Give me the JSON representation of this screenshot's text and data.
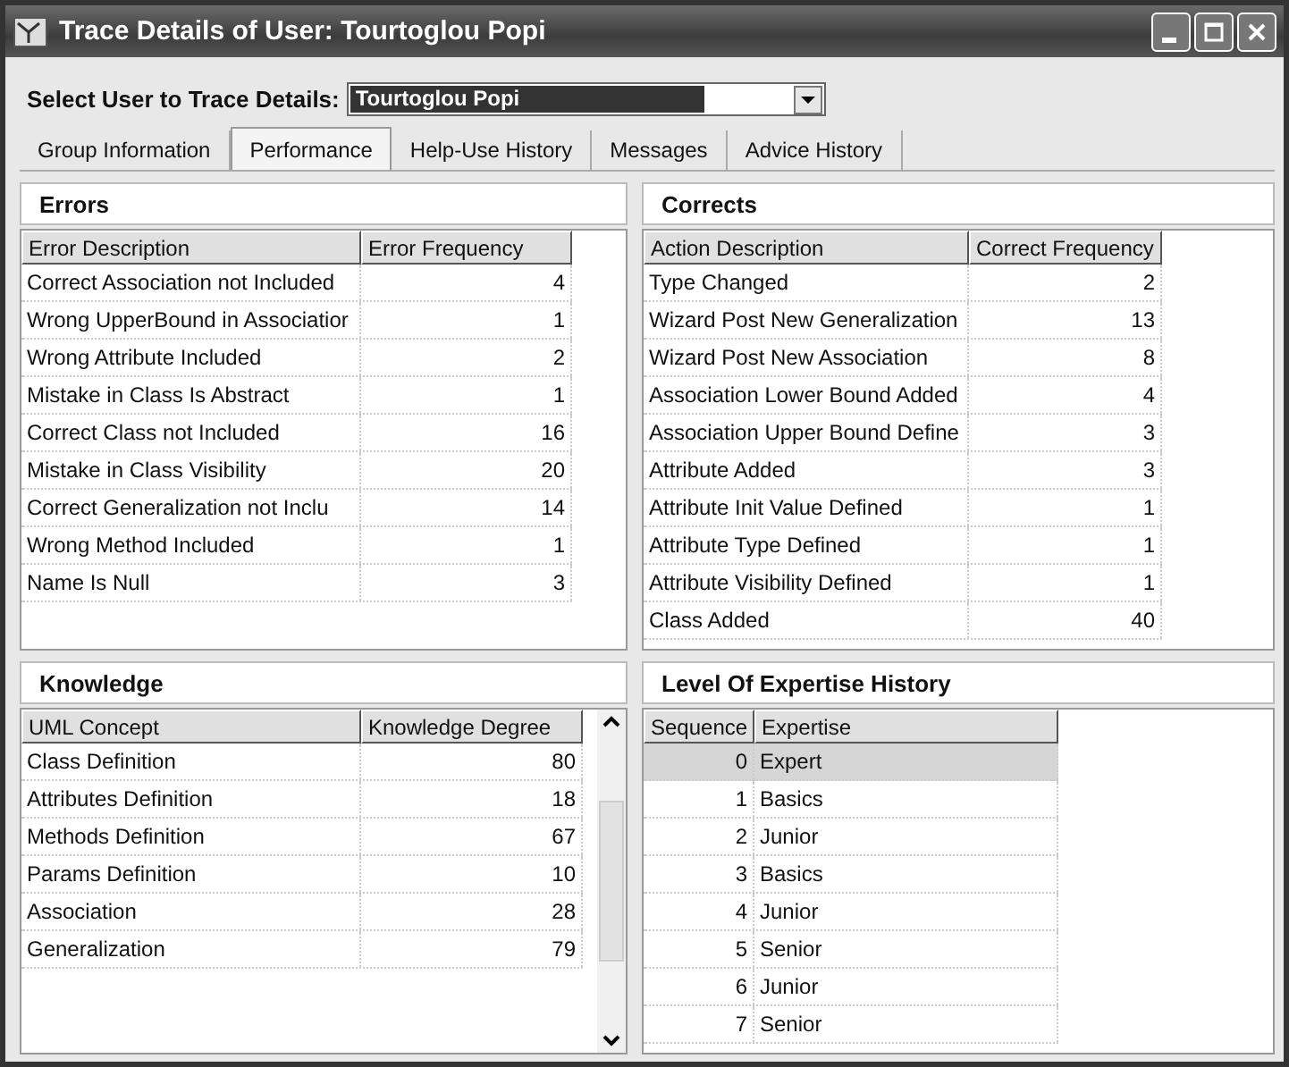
{
  "window": {
    "title": "Trace Details of User: Tourtoglou Popi"
  },
  "user_select": {
    "label": "Select User to Trace Details:",
    "value": "Tourtoglou Popi"
  },
  "tabs": [
    {
      "label": "Group Information",
      "selected": false
    },
    {
      "label": "Performance",
      "selected": true
    },
    {
      "label": "Help-Use History",
      "selected": false
    },
    {
      "label": "Messages",
      "selected": false
    },
    {
      "label": "Advice History",
      "selected": false
    }
  ],
  "panels": [
    {
      "title": "Errors",
      "scrollbar": false,
      "columns": [
        {
          "label": "Error Description",
          "kind": "text"
        },
        {
          "label": "Error Frequency",
          "kind": "number"
        }
      ],
      "rows": [
        {
          "cells": [
            "Correct Association not Included",
            "4"
          ],
          "selected": false
        },
        {
          "cells": [
            "Wrong UpperBound in Associatior",
            "1"
          ],
          "selected": false
        },
        {
          "cells": [
            "Wrong Attribute Included",
            "2"
          ],
          "selected": false
        },
        {
          "cells": [
            "Mistake in Class Is Abstract",
            "1"
          ],
          "selected": false
        },
        {
          "cells": [
            "Correct Class not Included",
            "16"
          ],
          "selected": false
        },
        {
          "cells": [
            "Mistake in Class Visibility",
            "20"
          ],
          "selected": false
        },
        {
          "cells": [
            "Correct Generalization not Inclu",
            "14"
          ],
          "selected": false
        },
        {
          "cells": [
            "Wrong Method Included",
            "1"
          ],
          "selected": false
        },
        {
          "cells": [
            "Name Is Null",
            "3"
          ],
          "selected": false
        }
      ]
    },
    {
      "title": "Corrects",
      "scrollbar": false,
      "columns": [
        {
          "label": "Action Description",
          "kind": "text"
        },
        {
          "label": "Correct Frequency",
          "kind": "number"
        }
      ],
      "rows": [
        {
          "cells": [
            "Type Changed",
            "2"
          ],
          "selected": false
        },
        {
          "cells": [
            "Wizard Post New Generalization",
            "13"
          ],
          "selected": false
        },
        {
          "cells": [
            "Wizard Post New Association",
            "8"
          ],
          "selected": false
        },
        {
          "cells": [
            "Association Lower Bound Added",
            "4"
          ],
          "selected": false
        },
        {
          "cells": [
            "Association Upper Bound Define",
            "3"
          ],
          "selected": false
        },
        {
          "cells": [
            "Attribute Added",
            "3"
          ],
          "selected": false
        },
        {
          "cells": [
            "Attribute Init Value Defined",
            "1"
          ],
          "selected": false
        },
        {
          "cells": [
            "Attribute Type Defined",
            "1"
          ],
          "selected": false
        },
        {
          "cells": [
            "Attribute Visibility Defined",
            "1"
          ],
          "selected": false
        },
        {
          "cells": [
            "Class Added",
            "40"
          ],
          "selected": false
        }
      ]
    },
    {
      "title": "Knowledge",
      "scrollbar": true,
      "columns": [
        {
          "label": "UML Concept",
          "kind": "text"
        },
        {
          "label": "Knowledge Degree",
          "kind": "number"
        }
      ],
      "rows": [
        {
          "cells": [
            "Class Definition",
            "80"
          ],
          "selected": false
        },
        {
          "cells": [
            "Attributes Definition",
            "18"
          ],
          "selected": false
        },
        {
          "cells": [
            "Methods Definition",
            "67"
          ],
          "selected": false
        },
        {
          "cells": [
            "Params Definition",
            "10"
          ],
          "selected": false
        },
        {
          "cells": [
            "Association",
            "28"
          ],
          "selected": false
        },
        {
          "cells": [
            "Generalization",
            "79"
          ],
          "selected": false
        }
      ]
    },
    {
      "title": "Level Of Expertise History",
      "scrollbar": false,
      "columns": [
        {
          "label": "Sequence",
          "kind": "number"
        },
        {
          "label": "Expertise",
          "kind": "text"
        }
      ],
      "rows": [
        {
          "cells": [
            "0",
            "Expert"
          ],
          "selected": true
        },
        {
          "cells": [
            "1",
            "Basics"
          ],
          "selected": false
        },
        {
          "cells": [
            "2",
            "Junior"
          ],
          "selected": false
        },
        {
          "cells": [
            "3",
            "Basics"
          ],
          "selected": false
        },
        {
          "cells": [
            "4",
            "Junior"
          ],
          "selected": false
        },
        {
          "cells": [
            "5",
            "Senior"
          ],
          "selected": false
        },
        {
          "cells": [
            "6",
            "Junior"
          ],
          "selected": false
        },
        {
          "cells": [
            "7",
            "Senior"
          ],
          "selected": false
        }
      ]
    }
  ]
}
